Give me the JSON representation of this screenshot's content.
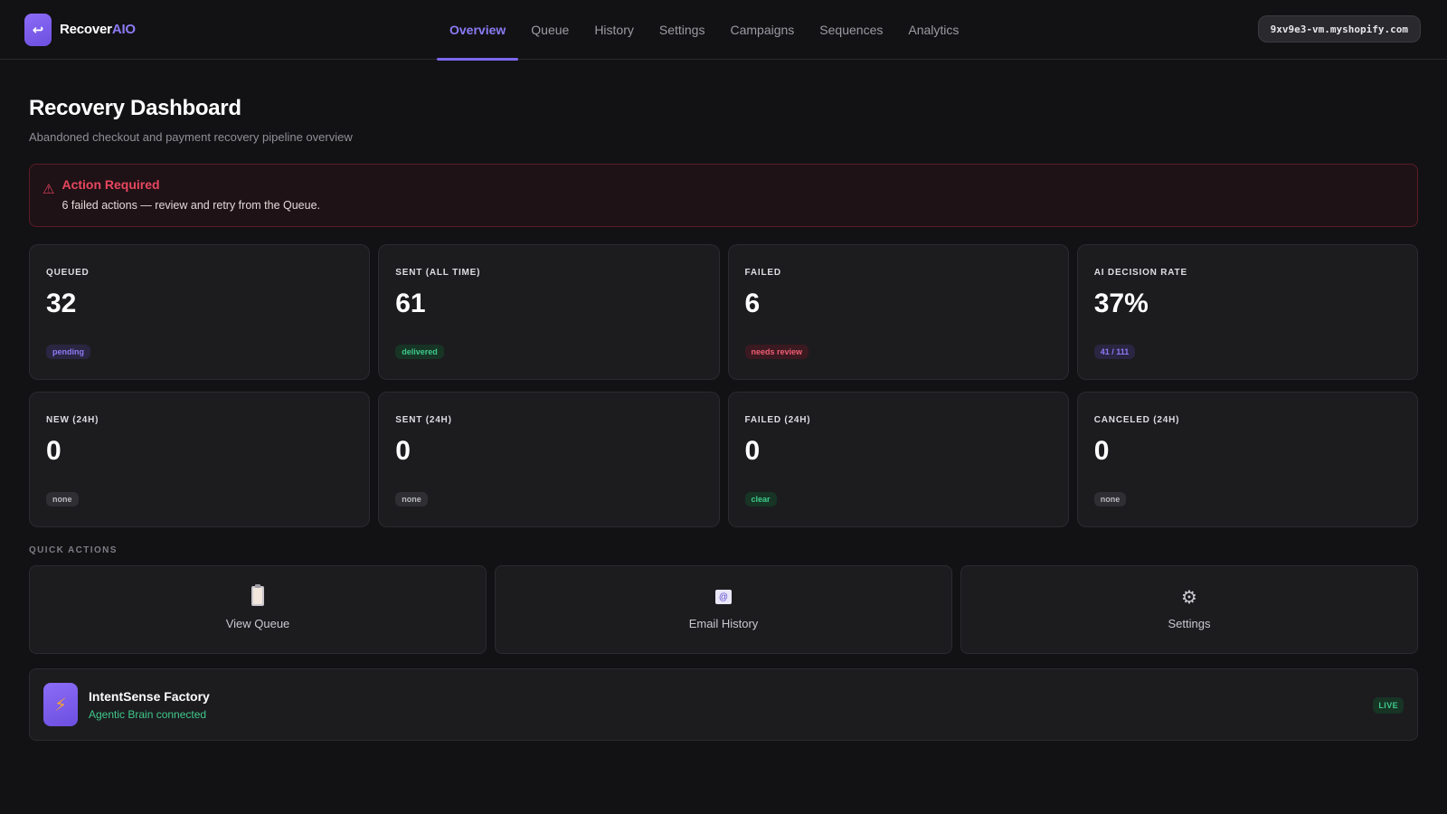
{
  "brand": {
    "name_main": "Recover",
    "name_accent": "AIO",
    "logo_icon": "return-arrow-icon"
  },
  "nav": {
    "tabs": [
      {
        "label": "Overview",
        "active": true
      },
      {
        "label": "Queue",
        "active": false
      },
      {
        "label": "History",
        "active": false
      },
      {
        "label": "Settings",
        "active": false
      },
      {
        "label": "Campaigns",
        "active": false
      },
      {
        "label": "Sequences",
        "active": false
      },
      {
        "label": "Analytics",
        "active": false
      }
    ]
  },
  "store": {
    "domain": "9xv9e3-vm.myshopify.com"
  },
  "page": {
    "title": "Recovery Dashboard",
    "subtitle": "Abandoned checkout and payment recovery pipeline overview"
  },
  "alert": {
    "title": "Action Required",
    "message": "6 failed actions — review and retry from the Queue."
  },
  "stats": [
    {
      "label": "QUEUED",
      "value": "32",
      "badge": "pending",
      "badge_color": "#8b7bf5"
    },
    {
      "label": "SENT (ALL TIME)",
      "value": "61",
      "badge": "delivered",
      "badge_color": "#3fc98a"
    },
    {
      "label": "FAILED",
      "value": "6",
      "badge": "needs review",
      "badge_color": "#ef5e73"
    },
    {
      "label": "AI DECISION RATE",
      "value": "37%",
      "badge": "41 / 111",
      "badge_color": "#8b7bf5"
    },
    {
      "label": "NEW (24H)",
      "value": "0",
      "badge": "none",
      "badge_color": "#b8b8c0"
    },
    {
      "label": "SENT (24H)",
      "value": "0",
      "badge": "none",
      "badge_color": "#b8b8c0"
    },
    {
      "label": "FAILED (24H)",
      "value": "0",
      "badge": "clear",
      "badge_color": "#3fc98a"
    },
    {
      "label": "CANCELED (24H)",
      "value": "0",
      "badge": "none",
      "badge_color": "#b8b8c0"
    }
  ],
  "quick_actions": {
    "label": "QUICK ACTIONS",
    "items": [
      {
        "label": "View Queue",
        "icon": "clipboard-icon"
      },
      {
        "label": "Email History",
        "icon": "email-icon"
      },
      {
        "label": "Settings",
        "icon": "gear-icon"
      }
    ]
  },
  "integration": {
    "title": "IntentSense Factory",
    "status": "Agentic Brain connected",
    "badge": "LIVE",
    "icon": "lightning-icon"
  },
  "colors": {
    "background": "#121214",
    "card": "#1c1c1f",
    "accent": "#8b7bf5",
    "success": "#3fc98a",
    "danger": "#e8475f"
  }
}
